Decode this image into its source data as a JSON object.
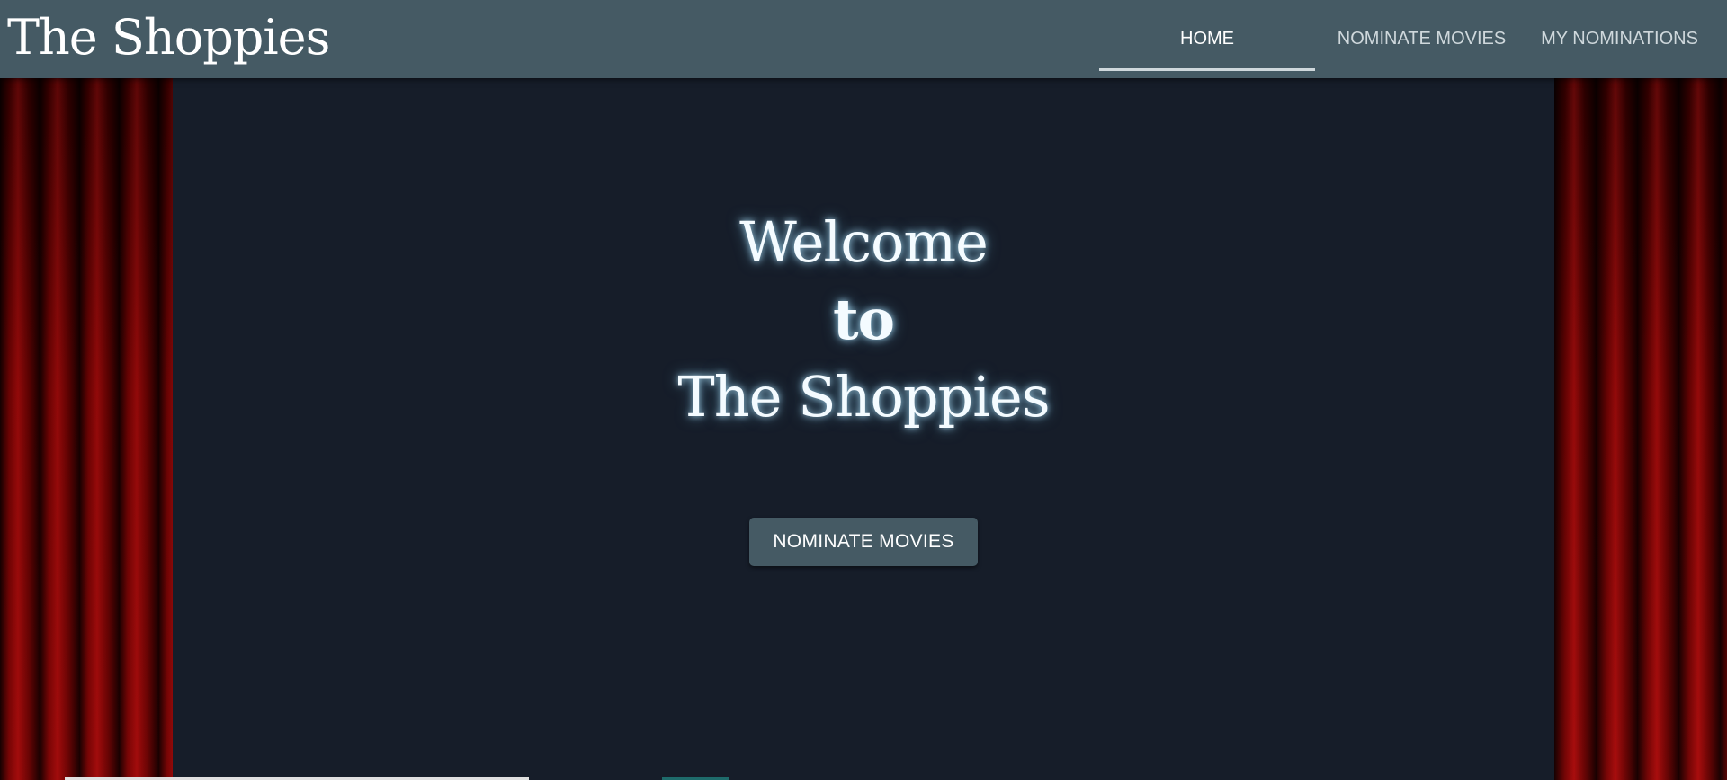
{
  "header": {
    "brand": "The Shoppies",
    "tabs": [
      {
        "label": "HOME",
        "active": true
      },
      {
        "label": "NOMINATE MOVIES",
        "active": false
      },
      {
        "label": "MY NOMINATIONS",
        "active": false
      }
    ]
  },
  "hero": {
    "line1": "Welcome",
    "line2": "to",
    "line3": "The Shoppies",
    "button_label": "NOMINATE MOVIES"
  },
  "colors": {
    "header_bg": "#455a64",
    "stage_bg": "#161d29",
    "curtain": "#8e0606",
    "button_bg": "#455a64",
    "glow": "#b4e6ff"
  }
}
